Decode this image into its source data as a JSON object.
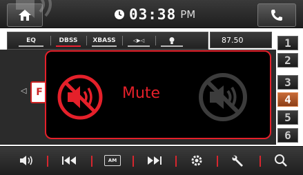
{
  "clock": {
    "time": "03:38",
    "ampm": "PM"
  },
  "audio_tabs": [
    {
      "label": "EQ",
      "active": false
    },
    {
      "label": "DBSS",
      "active": true
    },
    {
      "label": "XBASS",
      "active": false
    },
    {
      "label": "◁▶◁",
      "active": false
    },
    {
      "label": "💡",
      "active": false
    }
  ],
  "frequency": "87.50",
  "presets": [
    "1",
    "2",
    "3",
    "4",
    "5",
    "6"
  ],
  "active_preset": "4",
  "mute_popup": {
    "label": "Mute"
  },
  "left_chip": "F",
  "bottom_controls": [
    {
      "name": "volume-icon"
    },
    {
      "name": "previous-track-icon"
    },
    {
      "name": "am-band-icon",
      "text": "AM"
    },
    {
      "name": "next-track-icon"
    },
    {
      "name": "settings-icon"
    },
    {
      "name": "tools-icon"
    },
    {
      "name": "search-icon"
    }
  ],
  "colors": {
    "accent": "#e5202a",
    "active_preset": "#c76a37"
  }
}
